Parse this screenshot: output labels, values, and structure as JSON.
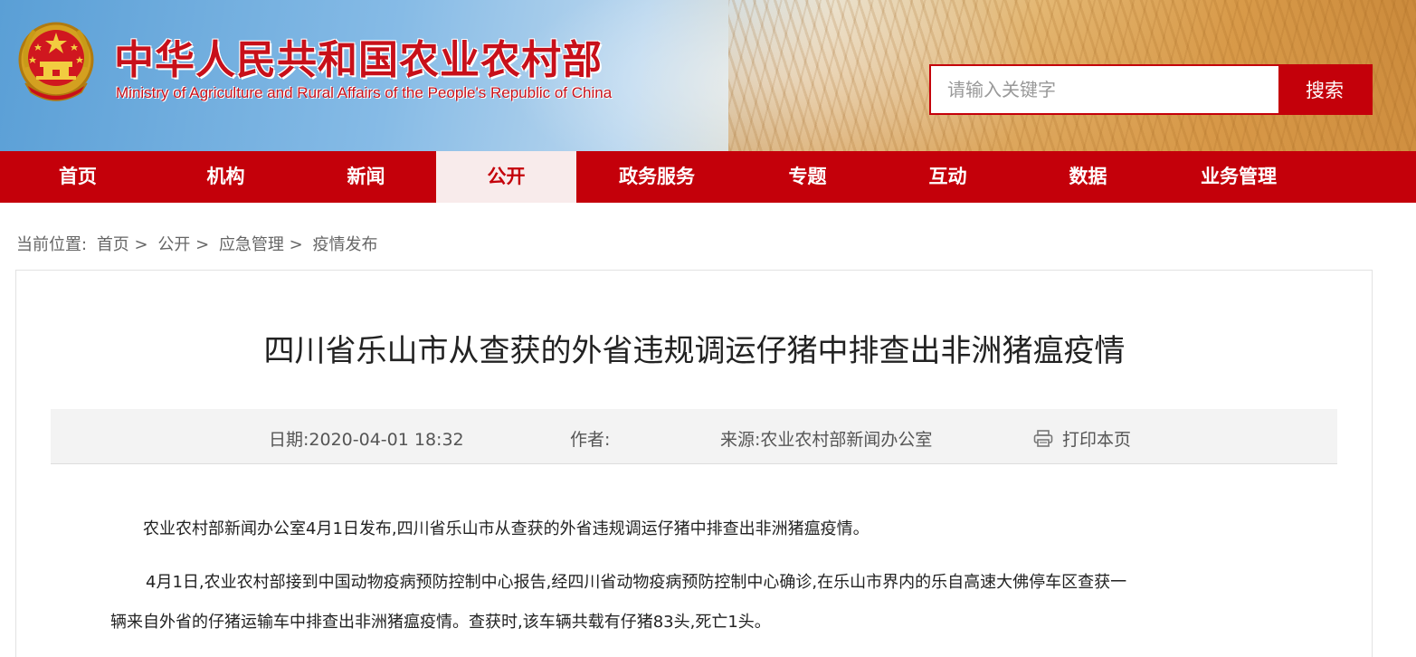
{
  "header": {
    "site_title": "中华人民共和国农业农村部",
    "site_subtitle": "Ministry of Agriculture and Rural Affairs of the People's Republic of China",
    "emblem_icon": "national-emblem-icon",
    "brand_color": "#c4000a"
  },
  "search": {
    "placeholder": "请输入关键字",
    "value": "",
    "button_label": "搜索"
  },
  "nav": {
    "items": [
      {
        "label": "首页"
      },
      {
        "label": "机构"
      },
      {
        "label": "新闻"
      },
      {
        "label": "公开"
      },
      {
        "label": "政务服务"
      },
      {
        "label": "专题"
      },
      {
        "label": "互动"
      },
      {
        "label": "数据"
      },
      {
        "label": "业务管理"
      }
    ],
    "active": "公开"
  },
  "breadcrumb": {
    "prefix": "当前位置:",
    "items": [
      "首页",
      "公开",
      "应急管理",
      "疫情发布"
    ],
    "separator": ">"
  },
  "article": {
    "title": "四川省乐山市从查获的外省违规调运仔猪中排查出非洲猪瘟疫情",
    "meta": {
      "date": "日期:2020-04-01 18:32",
      "author": "作者:",
      "source": "来源:农业农村部新闻办公室",
      "print_label": "打印本页",
      "print_icon": "printer-icon"
    },
    "paragraphs": [
      "农业农村部新闻办公室4月1日发布,四川省乐山市从查获的外省违规调运仔猪中排查出非洲猪瘟疫情。",
      "4月1日,农业农村部接到中国动物疫病预防控制中心报告,经四川省动物疫病预防控制中心确诊,在乐山市界内的乐自高速大佛停车区查获一",
      "辆来自外省的仔猪运输车中排查出非洲猪瘟疫情。查获时,该车辆共载有仔猪83头,死亡1头。"
    ]
  }
}
